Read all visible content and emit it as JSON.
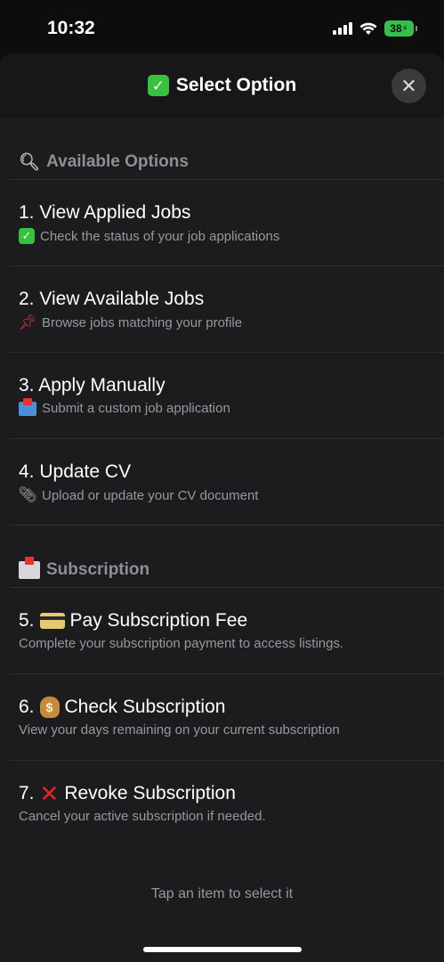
{
  "status_bar": {
    "time": "10:32",
    "battery": "38"
  },
  "sheet": {
    "title": "Select Option",
    "close_label": "✕"
  },
  "sections": [
    {
      "header": "Available Options",
      "header_icon": "magnifier-icon",
      "items": [
        {
          "title": "1. View Applied Jobs",
          "subtitle": "Check the status of your job applications",
          "icon": "check-box-icon"
        },
        {
          "title": "2. View Available Jobs",
          "subtitle": "Browse jobs matching your profile",
          "icon": "pushpin-icon"
        },
        {
          "title": "3. Apply Manually",
          "subtitle": "Submit a custom job application",
          "icon": "inbox-tray-icon"
        },
        {
          "title": "4. Update CV",
          "subtitle": "Upload or update your CV document",
          "icon": "paperclip-icon"
        }
      ]
    },
    {
      "header": "Subscription",
      "header_icon": "envelope-arrow-icon",
      "items": [
        {
          "number": "5.",
          "title": "Pay Subscription Fee",
          "subtitle": "Complete your subscription payment to access listings.",
          "icon": "credit-card-icon"
        },
        {
          "number": "6.",
          "title": "Check Subscription",
          "subtitle": "View your days remaining on your current subscription",
          "icon": "money-bag-icon"
        },
        {
          "number": "7.",
          "title": "Revoke Subscription",
          "subtitle": "Cancel your active subscription if needed.",
          "icon": "cross-mark-icon"
        }
      ]
    }
  ],
  "footer_hint": "Tap an item to select it",
  "colors": {
    "sheet_bg": "#1c1c1e",
    "accent_green": "#36c23f",
    "secondary_text": "#98989d"
  }
}
